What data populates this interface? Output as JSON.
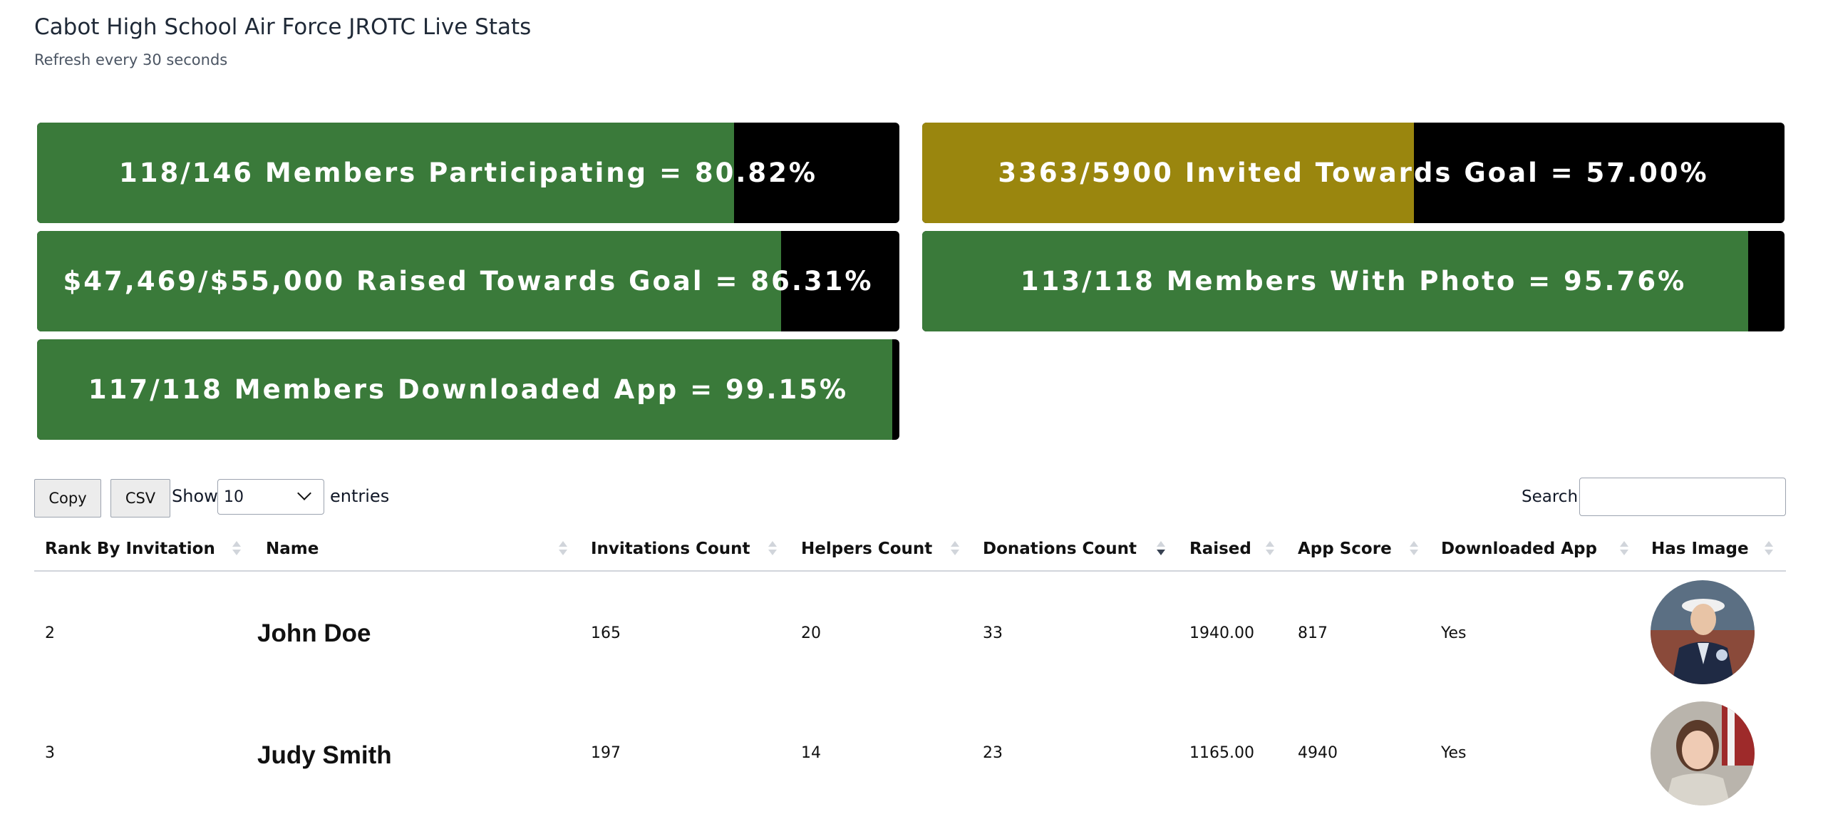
{
  "page": {
    "title": "Cabot High School Air Force JROTC Live Stats",
    "subtitle": "Refresh every 30 seconds"
  },
  "bars": [
    {
      "id": "bar1",
      "label": "118/146 Members Participating = 80.82%",
      "percent": 80.82,
      "color": "#3a7a3a"
    },
    {
      "id": "bar2",
      "label": "3363/5900 Invited Towards Goal = 57.00%",
      "percent": 57.0,
      "color": "#9a860e"
    },
    {
      "id": "bar3",
      "label": "$47,469/$55,000 Raised Towards Goal = 86.31%",
      "percent": 86.31,
      "color": "#3a7a3a"
    },
    {
      "id": "bar4",
      "label": "113/118 Members With Photo = 95.76%",
      "percent": 95.76,
      "color": "#3a7a3a"
    },
    {
      "id": "bar5",
      "label": "117/118 Members Downloaded App = 99.15%",
      "percent": 99.15,
      "color": "#3a7a3a"
    }
  ],
  "controls": {
    "copy_label": "Copy",
    "csv_label": "CSV",
    "show_label": "Show",
    "page_size": "10",
    "entries_label": "entries",
    "search_label": "Search:",
    "search_value": ""
  },
  "table": {
    "columns": [
      "Rank By Invitation",
      "Name",
      "Invitations Count",
      "Helpers Count",
      "Donations Count",
      "Raised",
      "App Score",
      "Downloaded App",
      "Has Image"
    ],
    "sorted_column": "Donations Count",
    "sort_direction": "desc",
    "rows": [
      {
        "rank": "2",
        "name": "John Doe",
        "invitations": "165",
        "helpers": "20",
        "donations": "33",
        "raised": "1940.00",
        "app_score": "817",
        "downloaded": "Yes",
        "avatar": "cadet-uniform-photo"
      },
      {
        "rank": "3",
        "name": "Judy Smith",
        "invitations": "197",
        "helpers": "14",
        "donations": "23",
        "raised": "1165.00",
        "app_score": "4940",
        "downloaded": "Yes",
        "avatar": "cadet-selfie-photo"
      }
    ]
  }
}
